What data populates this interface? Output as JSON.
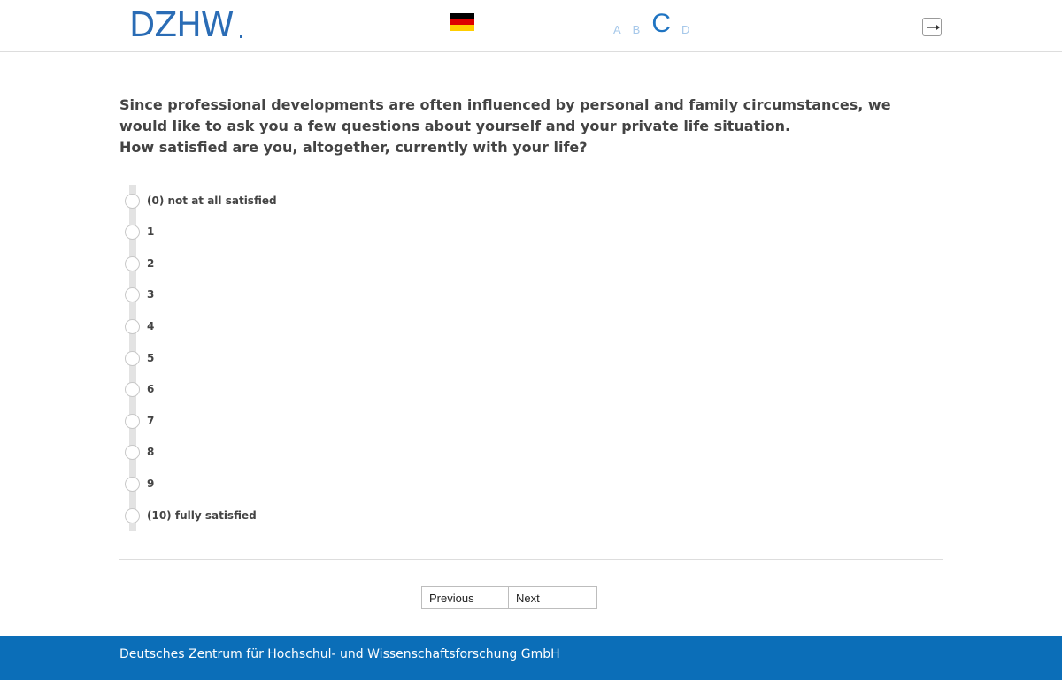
{
  "header": {
    "logo_text": "DZHW",
    "language_flag": "german-flag",
    "flag_colors": [
      "#000000",
      "#dd0000",
      "#ffce00"
    ],
    "font_sizes": [
      {
        "label": "A",
        "active": false
      },
      {
        "label": "B",
        "active": false
      },
      {
        "label": "C",
        "active": true
      },
      {
        "label": "D",
        "active": false
      }
    ],
    "exit_icon": "exit-icon"
  },
  "question": {
    "intro": "Since professional developments are often influenced by personal and family circumstances, we would like to ask you a few questions about yourself and your private life situation.",
    "text": "How satisfied are you, altogether, currently with your life?"
  },
  "options": [
    "(0) not at all satisfied",
    "1",
    "2",
    "3",
    "4",
    "5",
    "6",
    "7",
    "8",
    "9",
    "(10) fully satisfied"
  ],
  "navigation": {
    "previous_label": "Previous",
    "next_label": "Next"
  },
  "footer": {
    "text": "Deutsches Zentrum für Hochschul- und Wissenschaftsforschung GmbH"
  },
  "colors": {
    "brand_blue": "#0b6eb8",
    "logo_blue": "#2a6cb5",
    "font_size_inactive": "#a6c8ea"
  }
}
